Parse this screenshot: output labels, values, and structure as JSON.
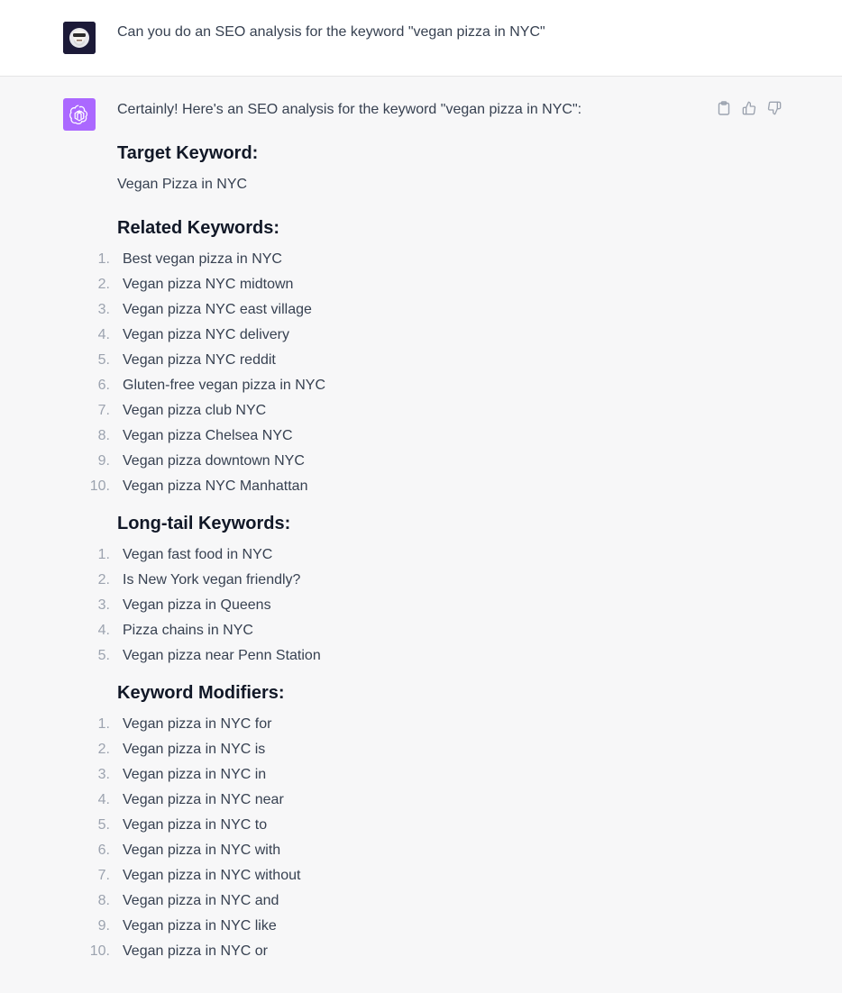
{
  "user": {
    "message": "Can you do an SEO analysis for the keyword \"vegan pizza in NYC\""
  },
  "assistant": {
    "intro": "Certainly! Here's an SEO analysis for the keyword \"vegan pizza in NYC\":",
    "sections": {
      "target": {
        "heading": "Target Keyword:",
        "text": "Vegan Pizza in NYC"
      },
      "related": {
        "heading": "Related Keywords:",
        "items": [
          "Best vegan pizza in NYC",
          "Vegan pizza NYC midtown",
          "Vegan pizza NYC east village",
          "Vegan pizza NYC delivery",
          "Vegan pizza NYC reddit",
          "Gluten-free vegan pizza in NYC",
          "Vegan pizza club NYC",
          "Vegan pizza Chelsea NYC",
          "Vegan pizza downtown NYC",
          "Vegan pizza NYC Manhattan"
        ]
      },
      "longtail": {
        "heading": "Long-tail Keywords:",
        "items": [
          "Vegan fast food in NYC",
          "Is New York vegan friendly?",
          "Vegan pizza in Queens",
          "Pizza chains in NYC",
          "Vegan pizza near Penn Station"
        ]
      },
      "modifiers": {
        "heading": "Keyword Modifiers:",
        "items": [
          "Vegan pizza in NYC for",
          "Vegan pizza in NYC is",
          "Vegan pizza in NYC in",
          "Vegan pizza in NYC near",
          "Vegan pizza in NYC to",
          "Vegan pizza in NYC with",
          "Vegan pizza in NYC without",
          "Vegan pizza in NYC and",
          "Vegan pizza in NYC like",
          "Vegan pizza in NYC or"
        ]
      }
    },
    "actions": {
      "copy_icon": "clipboard-icon",
      "like_icon": "thumbs-up-icon",
      "dislike_icon": "thumbs-down-icon"
    }
  },
  "colors": {
    "gpt_avatar": "#ab68ff",
    "background": "#f7f7f8",
    "heading": "#111827",
    "text": "#374151",
    "list_number": "#9ca3af"
  }
}
